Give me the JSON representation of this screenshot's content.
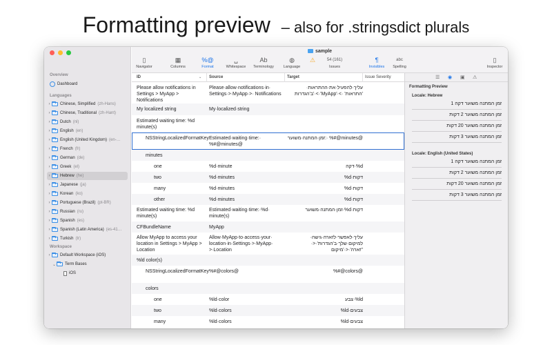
{
  "headline": {
    "main": "Formatting preview",
    "sub": "– also for .stringsdict plurals"
  },
  "sidebar": {
    "overview_label": "Overview",
    "dashboard_label": "Dashboard",
    "languages_label": "Languages",
    "languages": [
      {
        "name": "Chinese, Simplified",
        "code": "(zh-Hans)"
      },
      {
        "name": "Chinese, Traditional",
        "code": "(zh-Hant)"
      },
      {
        "name": "Dutch",
        "code": "(nl)"
      },
      {
        "name": "English",
        "code": "(en)"
      },
      {
        "name": "English (United Kingdom)",
        "code": "(en-…"
      },
      {
        "name": "French",
        "code": "(fr)"
      },
      {
        "name": "German",
        "code": "(de)"
      },
      {
        "name": "Greek",
        "code": "(el)"
      },
      {
        "name": "Hebrew",
        "code": "(he)"
      },
      {
        "name": "Japanese",
        "code": "(ja)"
      },
      {
        "name": "Korean",
        "code": "(ko)"
      },
      {
        "name": "Portuguese (Brazil)",
        "code": "(pt-BR)"
      },
      {
        "name": "Russian",
        "code": "(ru)"
      },
      {
        "name": "Spanish",
        "code": "(es)"
      },
      {
        "name": "Spanish (Latin America)",
        "code": "(es-41…"
      },
      {
        "name": "Turkish",
        "code": "(tr)"
      }
    ],
    "workspace_label": "Workspace",
    "workspace_default": "Default Workspace (iOS)",
    "term_bases": "Term Bases",
    "term_ios": "iOS"
  },
  "toolbar": {
    "title": "sample",
    "navigator": "Navigator",
    "columns": "Columns",
    "format": "Format",
    "whitespace": "Whitespace",
    "terminology": "Terminology",
    "language": "Language",
    "issues_count": "54 (161)",
    "issues": "Issues",
    "invisibles": "Invisibles",
    "spelling": "Spelling",
    "inspector": "Inspector"
  },
  "columns": {
    "id": "ID",
    "source": "Source",
    "target": "Target",
    "severity": "Issue Severity"
  },
  "rows": [
    {
      "id": "Please allow notifications in Settings > MyApp > Notifications",
      "source": "Please·allow·notifications·in· Settings·>·MyApp·>· Notifications",
      "target": "עליך·להפעיל·את·ההתראות· ב'הגדרות'·<·'MyApp'·<· 'התראות'"
    },
    {
      "id": "My localized string",
      "source": "My·localized·string",
      "target": ""
    },
    {
      "id": "Estimated waiting time: %d minute(s)",
      "source": "",
      "target": ""
    },
    {
      "id": "NSStringLocalizedFormatKey",
      "source": "Estimated·waiting·time:· %#@minutes@",
      "target": "זמן·המתנה·משוער:· %#@minutes@"
    },
    {
      "id": "minutes",
      "source": "",
      "target": ""
    },
    {
      "id": "one",
      "source": "%d·minute",
      "target": "דקה·%d"
    },
    {
      "id": "two",
      "source": "%d·minutes",
      "target": "%d·דקות"
    },
    {
      "id": "many",
      "source": "%d·minutes",
      "target": "%d·דקות"
    },
    {
      "id": "other",
      "source": "%d·minutes",
      "target": "%d·דקות"
    },
    {
      "id": "Estimated waiting time: %d minute(s)",
      "source": "Estimated·waiting·time:·%d· minute(s)",
      "target": "זמן·המתנה·משוער·%d·דקות"
    },
    {
      "id": "CFBundleName",
      "source": "MyApp",
      "target": ""
    },
    {
      "id": "Allow MyApp to access your location in Settings > MyApp > Location",
      "source": "Allow·MyApp·to·access·your· location·in·Settings·>·MyApp· >·Location",
      "target": "עליך·לאפשר·לזארה·גישה· למיקום·שלך·ב'הגדרות'·<· 'זארה'·<·'מיקום'"
    },
    {
      "id": "%ld color(s)",
      "source": "",
      "target": ""
    },
    {
      "id": "NSStringLocalizedFormatKey",
      "source": "%#@colors@",
      "target": "%#@colors@"
    },
    {
      "id": "colors",
      "source": "",
      "target": ""
    },
    {
      "id": "one",
      "source": "%ld·color",
      "target": "צבע·%ld"
    },
    {
      "id": "two",
      "source": "%ld·colors",
      "target": "%ld·צבעים"
    },
    {
      "id": "many",
      "source": "%ld·colors",
      "target": "%ld·צבעים"
    }
  ],
  "inspector": {
    "title": "Formatting Preview",
    "locale_he": "Locale: Hebrew",
    "locale_en": "Locale: English (United States)",
    "he_lines": [
      "זמן המתנה משוער דקה 1",
      "זמן המתנה משוער 2 דקות",
      "זמן המתנה משוער 20 דקות",
      "זמן המתנה משוער 3 דקות"
    ],
    "en_lines": [
      "זמן המתנה משוער דקה 1",
      "זמן המתנה משוער 2 דקות",
      "זמן המתנה משוער 20 דקות",
      "זמן המתנה משוער 3 דקות"
    ]
  }
}
